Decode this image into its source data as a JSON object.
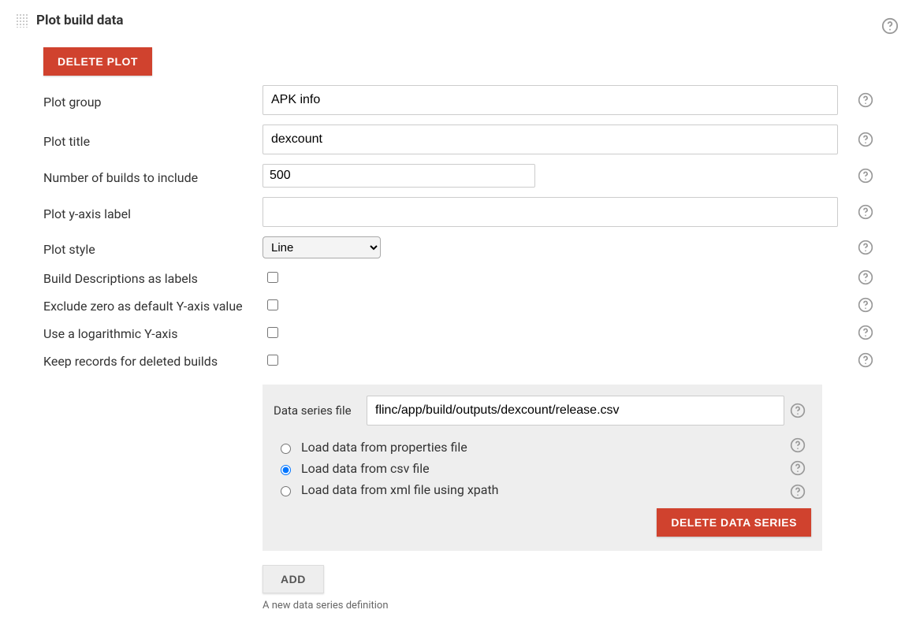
{
  "section": {
    "title": "Plot build data"
  },
  "buttons": {
    "delete_plot": "DELETE PLOT",
    "delete_series": "DELETE DATA SERIES",
    "add": "ADD"
  },
  "labels": {
    "plot_group": "Plot group",
    "plot_title": "Plot title",
    "num_builds": "Number of builds to include",
    "y_axis": "Plot y-axis label",
    "plot_style": "Plot style",
    "build_desc": "Build Descriptions as labels",
    "exclude_zero": "Exclude zero as default Y-axis value",
    "log_y": "Use a logarithmic Y-axis",
    "keep_deleted": "Keep records for deleted builds",
    "series_file": "Data series file"
  },
  "values": {
    "plot_group": "APK info",
    "plot_title": "dexcount",
    "num_builds": "500",
    "y_axis": "",
    "plot_style": "Line",
    "series_file": "flinc/app/build/outputs/dexcount/release.csv"
  },
  "radios": {
    "properties": "Load data from properties file",
    "csv": "Load data from csv file",
    "xml": "Load data from xml file using xpath"
  },
  "hint": "A new data series definition"
}
